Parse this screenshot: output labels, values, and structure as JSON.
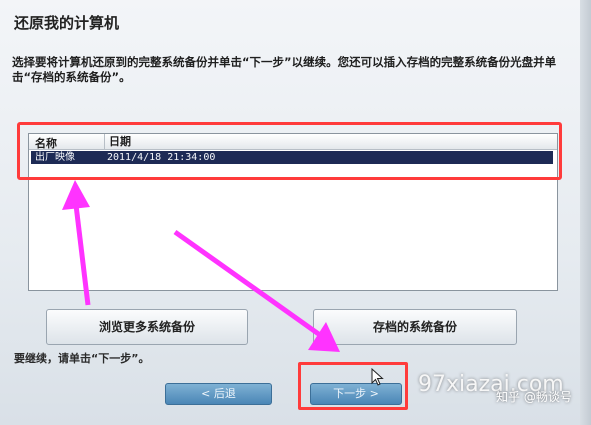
{
  "window": {
    "title": "还原我的计算机",
    "description": "选择要将计算机还原到的完整系统备份并单击“下一步”以继续。您还可以插入存档的完整系统备份光盘并单击“存档的系统备份”。"
  },
  "backup_list": {
    "columns": [
      "名称",
      "日期"
    ],
    "rows": [
      {
        "name": "出厂映像",
        "date": "2011/4/18 21:34:00",
        "selected": true
      }
    ]
  },
  "buttons": {
    "browse": "浏览更多系统备份",
    "archive": "存档的系统备份",
    "back": "< 后退",
    "next": "下一步 >"
  },
  "hint": "要继续，请单击“下一步”。",
  "watermarks": {
    "site": "97xiazai.com",
    "author": "知乎 @畅谈号"
  },
  "colors": {
    "annotation_red": "#ff3b3b",
    "annotation_magenta": "#ff33ff",
    "selected_row": "#1d2a55"
  }
}
